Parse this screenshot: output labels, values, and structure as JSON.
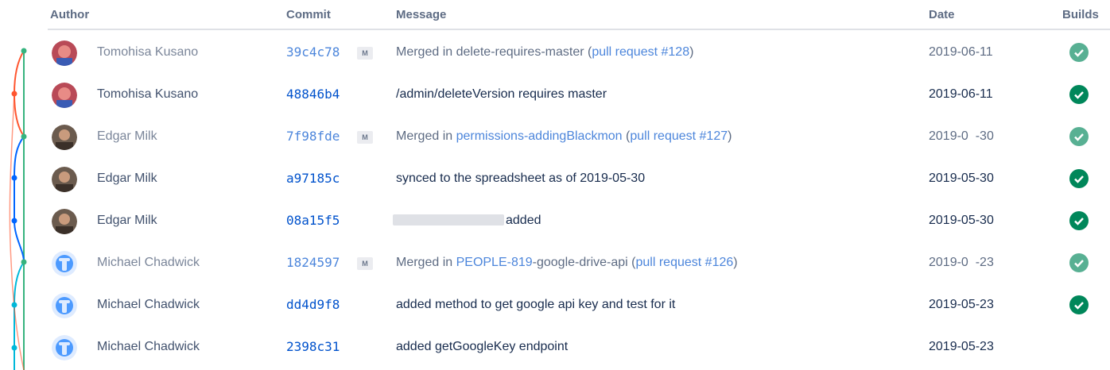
{
  "header": {
    "author": "Author",
    "commit": "Commit",
    "message": "Message",
    "date": "Date",
    "builds": "Builds"
  },
  "merge_badge": "M",
  "colors": {
    "link": "#0052cc",
    "build_success": "#00875a",
    "graph_red": "#ff5630",
    "graph_green": "#36b37e",
    "graph_blue": "#0065ff",
    "graph_cyan": "#00b8d9"
  },
  "rows": [
    {
      "author": "Tomohisa Kusano",
      "avatar": "red-avatar-icon",
      "commit": "39c4c78",
      "merge": true,
      "message_prefix": "Merged in delete-requires-master (",
      "message_link": "pull request #128",
      "message_suffix": ")",
      "date": "2019-06-11",
      "build": "success"
    },
    {
      "author": "Tomohisa Kusano",
      "avatar": "red-avatar-icon",
      "commit": "48846b4",
      "merge": false,
      "message_prefix": "/admin/deleteVersion requires master",
      "date": "2019-06-11",
      "build": "success"
    },
    {
      "author": "Edgar Milk",
      "avatar": "person-photo-icon",
      "commit": "7f98fde",
      "merge": true,
      "message_prefix": "Merged in ",
      "message_link_branch": "permissions-addingBlackmon",
      "message_mid": " (",
      "message_link": "pull request #127",
      "message_suffix": ")",
      "date": "2019-0  -30",
      "build": "success"
    },
    {
      "author": "Edgar Milk",
      "avatar": "person-photo-icon",
      "commit": "a97185c",
      "merge": false,
      "message_prefix": "synced to the spreadsheet as of 2019-05-30",
      "date": "2019-05-30",
      "build": "success"
    },
    {
      "author": "Edgar Milk",
      "avatar": "person-photo-icon",
      "commit": "08a15f5",
      "merge": false,
      "message_redacted": true,
      "message_prefix": "added",
      "date": "2019-05-30",
      "build": "success"
    },
    {
      "author": "Michael Chadwick",
      "avatar": "blue-default-avatar-icon",
      "commit": "1824597",
      "merge": true,
      "message_prefix": "Merged in ",
      "message_link_branch": "PEOPLE-819",
      "message_mid": "-google-drive-api (",
      "message_link": "pull request #126",
      "message_suffix": ")",
      "date": "2019-0  -23",
      "build": "success"
    },
    {
      "author": "Michael Chadwick",
      "avatar": "blue-default-avatar-icon",
      "commit": "dd4d9f8",
      "merge": false,
      "message_prefix": "added method to get google api key and test for it",
      "date": "2019-05-23",
      "build": "success"
    },
    {
      "author": "Michael Chadwick",
      "avatar": "blue-default-avatar-icon",
      "commit": "2398c31",
      "merge": false,
      "message_prefix": "added getGoogleKey endpoint",
      "date": "2019-05-23",
      "build": "none"
    }
  ]
}
